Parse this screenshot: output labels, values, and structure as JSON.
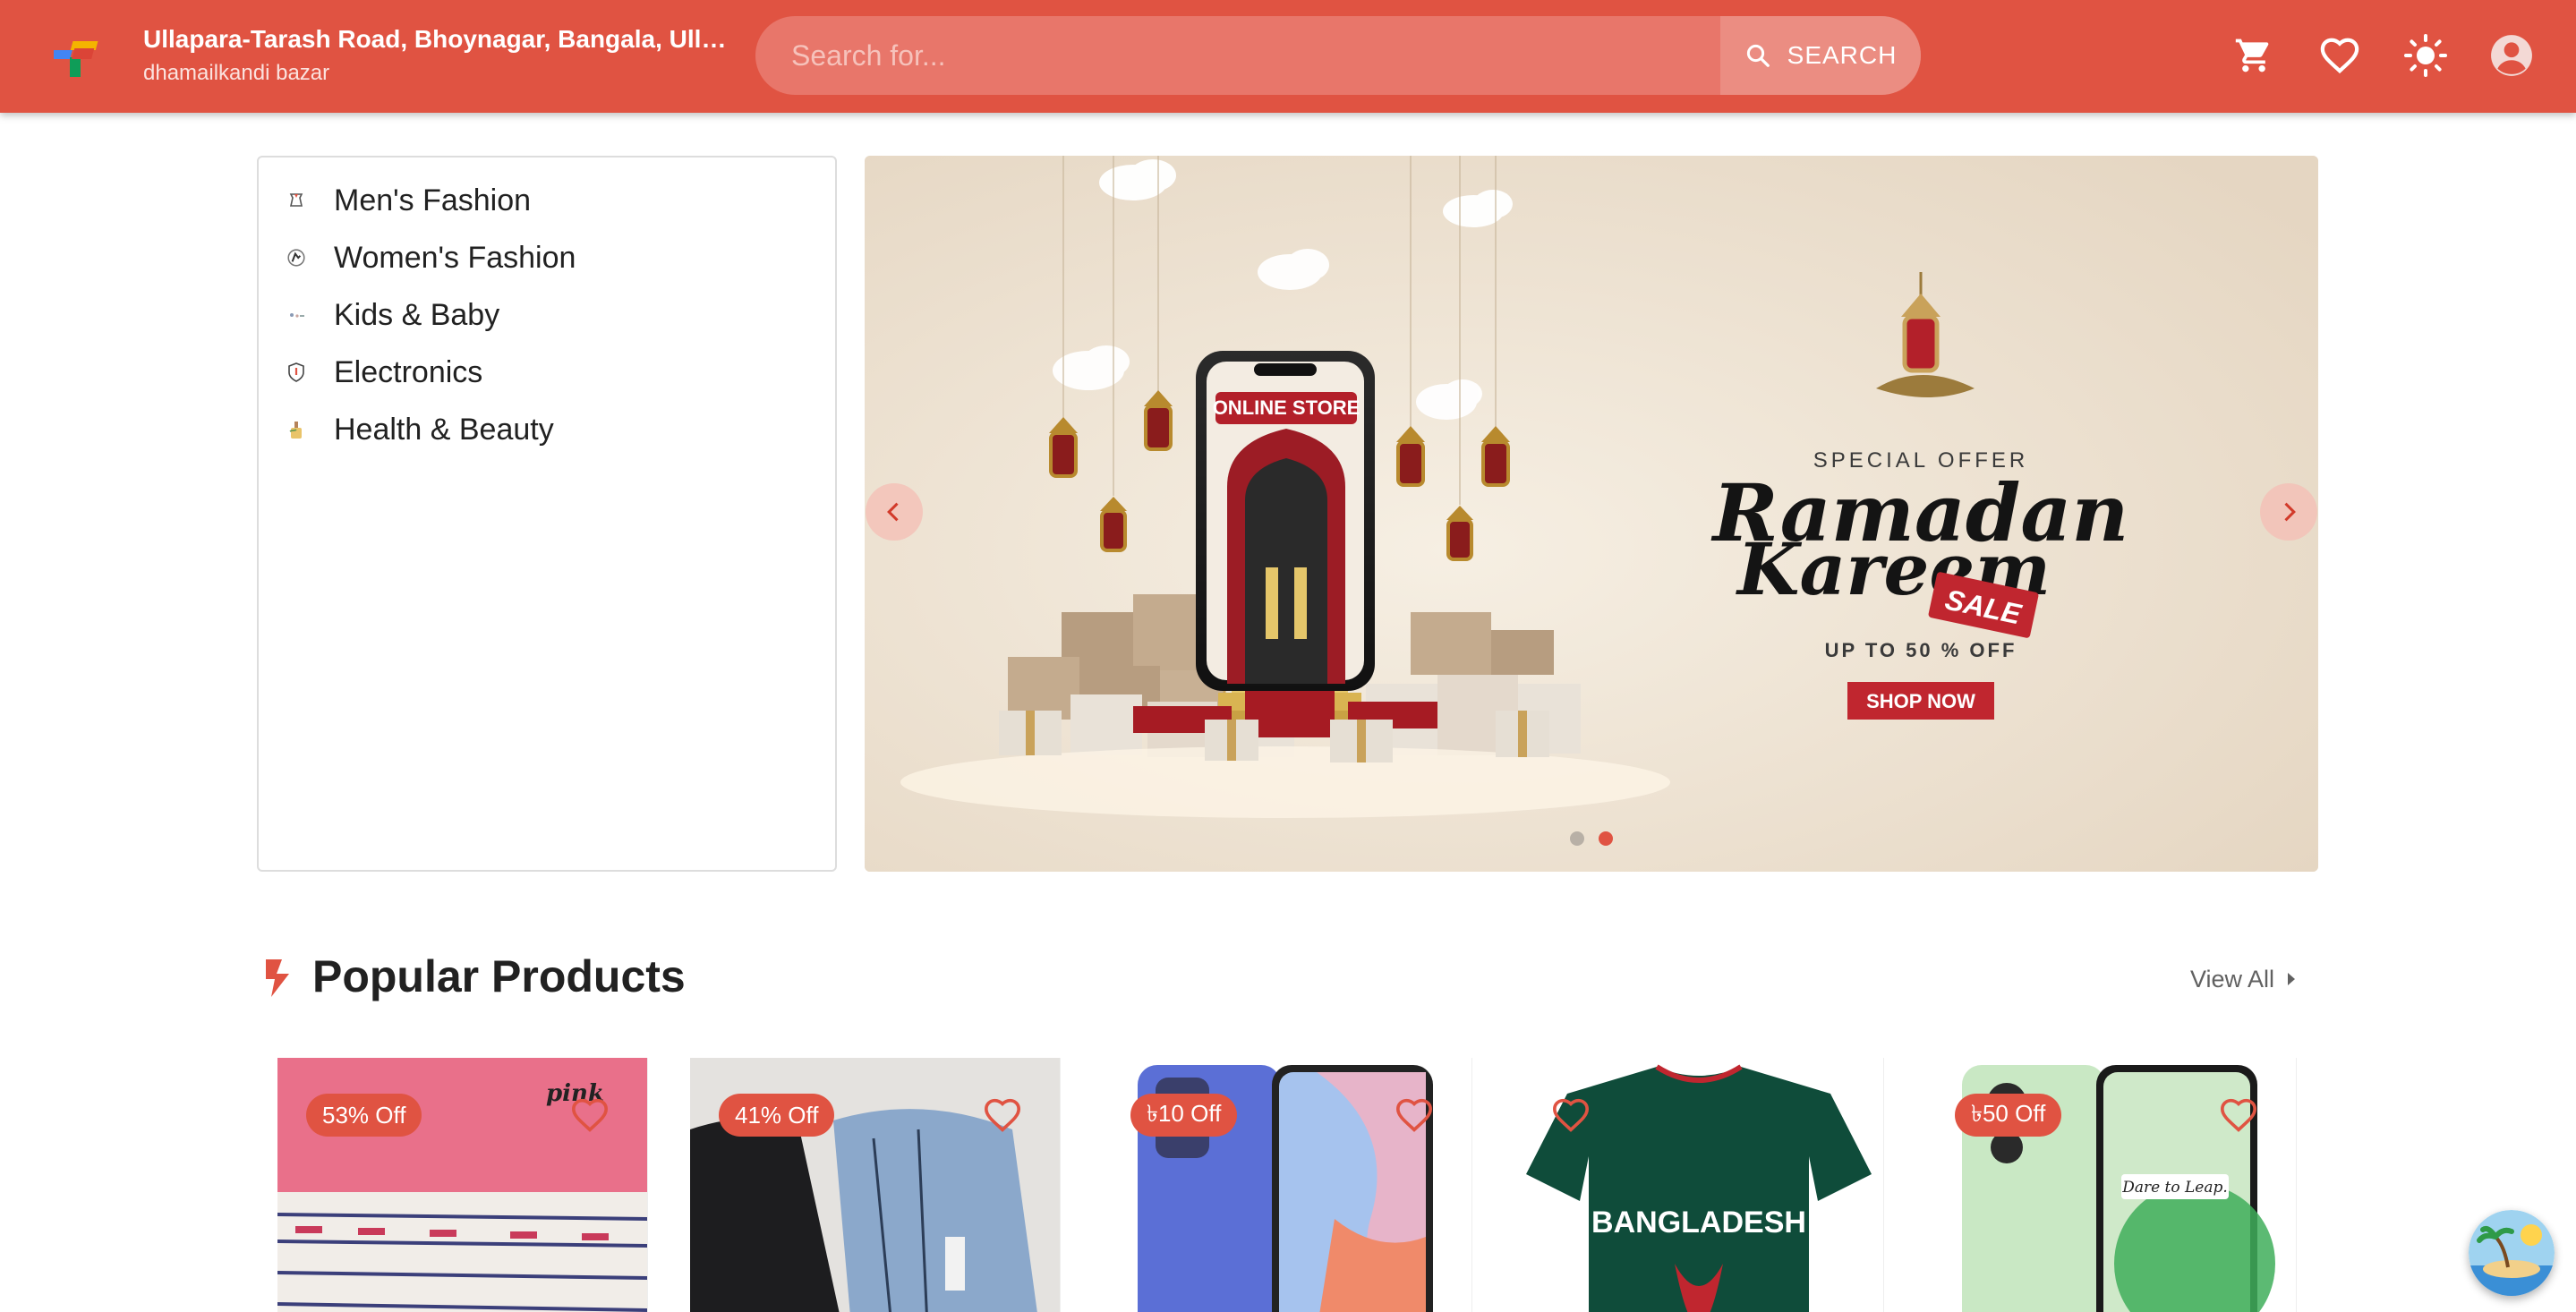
{
  "header": {
    "address_title": "Ullapara-Tarash Road, Bhoynagar, Bangala, Ullapara, Sirajganj",
    "address_subtitle": "dhamailkandi bazar",
    "search_placeholder": "Search for...",
    "search_button": "SEARCH",
    "icons": [
      "cart-icon",
      "heart-icon",
      "sun-icon",
      "account-icon"
    ]
  },
  "categories": [
    {
      "label": "Men's Fashion",
      "icon": "mens-fashion-icon"
    },
    {
      "label": "Women's Fashion",
      "icon": "womens-fashion-icon"
    },
    {
      "label": "Kids & Baby",
      "icon": "kids-baby-icon"
    },
    {
      "label": "Electronics",
      "icon": "electronics-icon"
    },
    {
      "label": "Health & Beauty",
      "icon": "health-beauty-icon"
    }
  ],
  "banner": {
    "screen_label": "ONLINE STORE",
    "special_offer": "SPECIAL OFFER",
    "headline_1": "Ramadan",
    "headline_2": "Kareem",
    "sale_tag": "SALE",
    "discount": "UP TO 50 % OFF",
    "cta": "SHOP NOW",
    "slide_count": 2,
    "active_slide": 2
  },
  "popular": {
    "title": "Popular Products",
    "view_all": "View All",
    "products": [
      {
        "badge": "53% Off",
        "image": "pink saree",
        "brand_mark": "pink"
      },
      {
        "badge": "41% Off",
        "image": "shirts"
      },
      {
        "badge": "৳10 Off",
        "image": "smartphone blue"
      },
      {
        "badge": "",
        "image": "bangladesh jersey",
        "jersey_text": "BANGLADESH"
      },
      {
        "badge": "৳50 Off",
        "image": "smartphone green",
        "tagline": "Dare to Leap."
      }
    ]
  },
  "colors": {
    "primary": "#e05342",
    "header_search": "#e8766a",
    "banner_bg": "#e8dccb"
  }
}
